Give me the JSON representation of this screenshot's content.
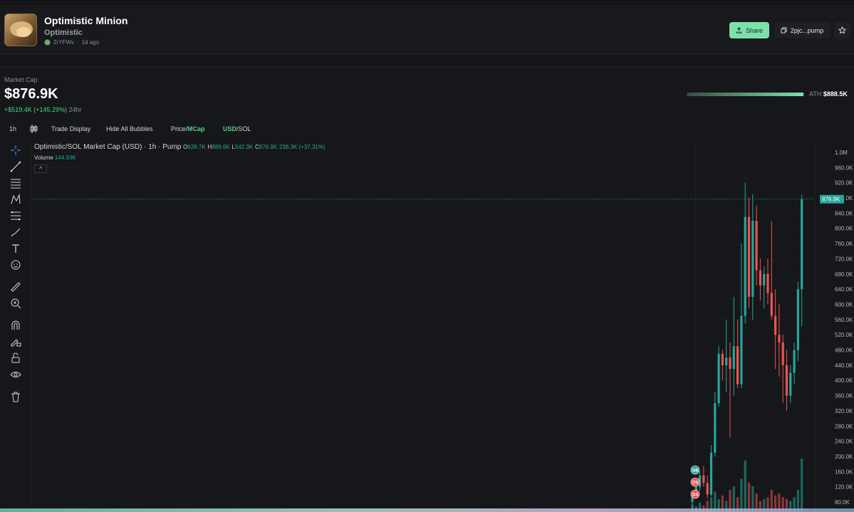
{
  "token": {
    "name": "Optimistic Minion",
    "ticker": "Optimistic",
    "creator": "2rYFWv",
    "age": "1d ago"
  },
  "actions": {
    "share_label": "Share",
    "address_label": "2pjc...pump"
  },
  "market": {
    "label": "Market Cap",
    "value": "$876.9K",
    "change": "+$519.4K (+145.29%)",
    "period": "24hr",
    "ath_label": "ATH",
    "ath_value": "$888.5K",
    "ath_progress": 0.987
  },
  "toolbar": {
    "interval": "1h",
    "trade_display": "Trade Display",
    "hide_bubbles": "Hide All Bubbles",
    "price_label": "Price/",
    "mcap_label": "MCap",
    "usd_label": "USD",
    "sol_label": "/SOL"
  },
  "chart": {
    "legend_title": "Optimistic/SOL Market Cap (USD) · 1h · Pump",
    "o_label": "O",
    "o_value": "638.7K",
    "h_label": "H",
    "h_value": "889.6K",
    "l_label": "L",
    "l_value": "542.3K",
    "c_label": "C",
    "c_value": "876.9K",
    "change": "238.3K (+37.31%)",
    "volume_label": "Volume",
    "volume_value": "144.93K",
    "collapse_symbol": "^",
    "price_tag": "876.9K",
    "markers": [
      "DB",
      "DS",
      "DS"
    ]
  },
  "chart_data": {
    "type": "candlestick",
    "title": "Optimistic/SOL Market Cap (USD) · 1h · Pump",
    "y_ticks": [
      "1.0M",
      "960.0K",
      "920.0K",
      "880.0K",
      "840.0K",
      "800.0K",
      "760.0K",
      "720.0K",
      "680.0K",
      "640.0K",
      "600.0K",
      "560.0K",
      "520.0K",
      "480.0K",
      "440.0K",
      "400.0K",
      "360.0K",
      "320.0K",
      "280.0K",
      "240.0K",
      "200.0K",
      "160.0K",
      "120.0K",
      "80.0K"
    ],
    "ylim": [
      70000,
      1020000
    ],
    "last_value": 876900,
    "candles": [
      {
        "o": 80000,
        "h": 110000,
        "l": 60000,
        "c": 100000
      },
      {
        "o": 100000,
        "h": 130000,
        "l": 90000,
        "c": 120000
      },
      {
        "o": 120000,
        "h": 160000,
        "l": 110000,
        "c": 150000
      },
      {
        "o": 150000,
        "h": 175000,
        "l": 120000,
        "c": 130000
      },
      {
        "o": 130000,
        "h": 150000,
        "l": 90000,
        "c": 100000
      },
      {
        "o": 100000,
        "h": 230000,
        "l": 95000,
        "c": 210000
      },
      {
        "o": 210000,
        "h": 370000,
        "l": 200000,
        "c": 340000
      },
      {
        "o": 340000,
        "h": 490000,
        "l": 330000,
        "c": 470000
      },
      {
        "o": 470000,
        "h": 480000,
        "l": 400000,
        "c": 440000
      },
      {
        "o": 440000,
        "h": 560000,
        "l": 370000,
        "c": 460000
      },
      {
        "o": 460000,
        "h": 500000,
        "l": 250000,
        "c": 430000
      },
      {
        "o": 430000,
        "h": 620000,
        "l": 360000,
        "c": 490000
      },
      {
        "o": 490000,
        "h": 560000,
        "l": 380000,
        "c": 390000
      },
      {
        "o": 390000,
        "h": 760000,
        "l": 380000,
        "c": 570000
      },
      {
        "o": 570000,
        "h": 920000,
        "l": 550000,
        "c": 830000
      },
      {
        "o": 830000,
        "h": 880000,
        "l": 590000,
        "c": 620000
      },
      {
        "o": 620000,
        "h": 890000,
        "l": 560000,
        "c": 820000
      },
      {
        "o": 820000,
        "h": 860000,
        "l": 650000,
        "c": 690000
      },
      {
        "o": 690000,
        "h": 720000,
        "l": 610000,
        "c": 650000
      },
      {
        "o": 650000,
        "h": 700000,
        "l": 590000,
        "c": 680000
      },
      {
        "o": 680000,
        "h": 720000,
        "l": 600000,
        "c": 630000
      },
      {
        "o": 630000,
        "h": 820000,
        "l": 560000,
        "c": 570000
      },
      {
        "o": 570000,
        "h": 640000,
        "l": 430000,
        "c": 520000
      },
      {
        "o": 520000,
        "h": 600000,
        "l": 410000,
        "c": 500000
      },
      {
        "o": 500000,
        "h": 520000,
        "l": 340000,
        "c": 440000
      },
      {
        "o": 440000,
        "h": 480000,
        "l": 320000,
        "c": 360000
      },
      {
        "o": 360000,
        "h": 440000,
        "l": 340000,
        "c": 420000
      },
      {
        "o": 420000,
        "h": 500000,
        "l": 390000,
        "c": 480000
      },
      {
        "o": 480000,
        "h": 660000,
        "l": 450000,
        "c": 640000
      },
      {
        "o": 640000,
        "h": 889600,
        "l": 542300,
        "c": 876900
      }
    ],
    "volume": [
      20,
      15,
      25,
      18,
      30,
      40,
      55,
      35,
      45,
      30,
      60,
      70,
      40,
      90,
      140,
      80,
      70,
      50,
      30,
      35,
      40,
      60,
      45,
      50,
      40,
      35,
      30,
      40,
      60,
      144.93
    ]
  },
  "colors": {
    "up": "#26a69a",
    "down": "#ef5350",
    "accent": "#7ee0a9"
  }
}
